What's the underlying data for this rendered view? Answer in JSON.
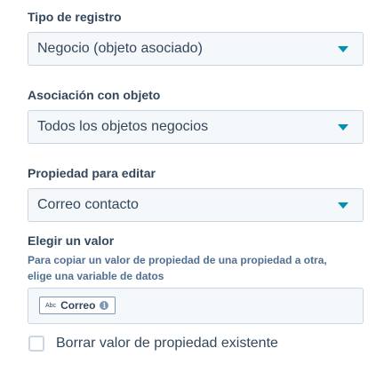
{
  "record_type": {
    "label": "Tipo de registro",
    "value": "Negocio (objeto asociado)"
  },
  "association": {
    "label": "Asociación con objeto",
    "value": "Todos los objetos negocios"
  },
  "property": {
    "label": "Propiedad para editar",
    "value": "Correo contacto"
  },
  "choose_value": {
    "label": "Elegir un valor",
    "help_line1": "Para copiar un valor de propiedad de una propiedad a otra,",
    "help_line2": "elige una variable de datos",
    "token": {
      "type_label": "Abc",
      "name": "Correo",
      "info_icon": "info-icon"
    }
  },
  "clear_existing": {
    "label": "Borrar valor de propiedad existente",
    "checked": false
  },
  "colors": {
    "text": "#33475b",
    "accent": "#0091ae",
    "field_bg": "#f5f8fa",
    "border": "#cbd6e2"
  }
}
